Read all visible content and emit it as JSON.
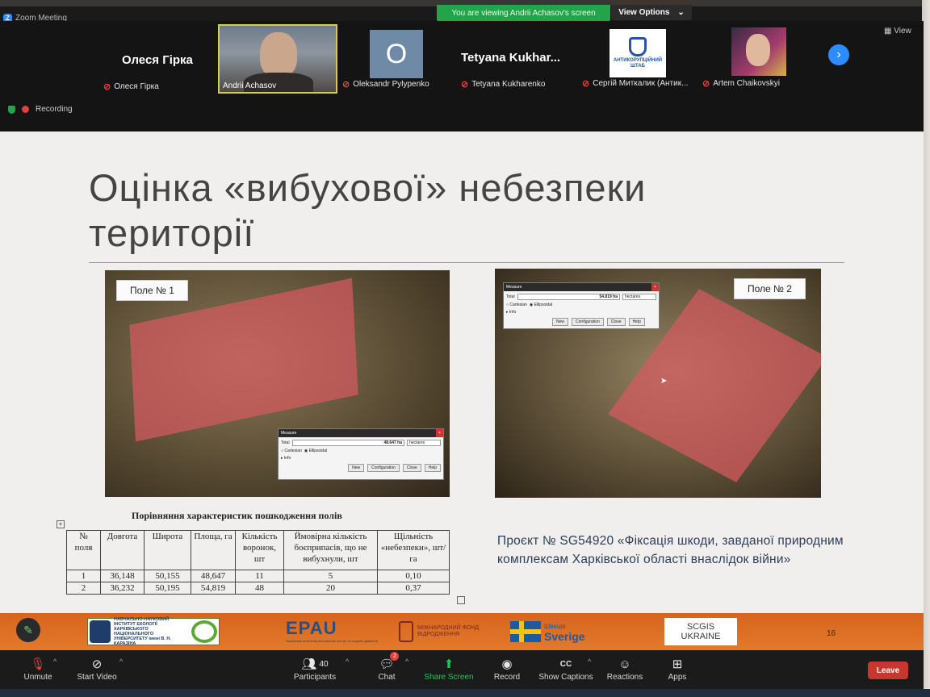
{
  "window": {
    "app_title": "Zoom Meeting",
    "viewing_banner": "You are viewing Andrii Achasov's screen",
    "view_options_label": "View Options",
    "view_label": "View",
    "recording_label": "Recording"
  },
  "participants": [
    {
      "big_name": "Олеся Гірка",
      "label": "Олеся Гірка",
      "muted": true
    },
    {
      "label": "Andrii Achasov",
      "video": true
    },
    {
      "avatar_letter": "O",
      "label": "Oleksandr Pylypenko",
      "muted": true
    },
    {
      "big_name": "Tetyana  Kukhar...",
      "label": "Tetyana Kukharenko",
      "muted": true
    },
    {
      "logo_text": "АНТИКОРУПЦІЙНИЙ ШТАБ",
      "label": "Сергій Миткалик (Антик...",
      "muted": true
    },
    {
      "label": "Artem Chaikovskyi",
      "muted": true
    }
  ],
  "slide": {
    "title_line1": "Оцінка «вибухової» небезпеки",
    "title_line2": "території",
    "field1_label": "Поле № 1",
    "field2_label": "Поле № 2",
    "measure1": {
      "title": "Measure",
      "total_label": "Total",
      "total_value": "48.647 ha",
      "unit": "hectares",
      "opt1": "Cartesian",
      "opt2": "Ellipsoidal",
      "info": "Info",
      "buttons": [
        "New",
        "Configuration",
        "Close",
        "Help"
      ]
    },
    "measure2": {
      "title": "Measure",
      "total_label": "Total",
      "total_value": "54.819 ha",
      "unit": "hectares",
      "opt1": "Cartesian",
      "opt2": "Ellipsoidal",
      "info": "Info",
      "buttons": [
        "New",
        "Configuration",
        "Close",
        "Help"
      ]
    },
    "table_caption": "Порівняння характеристик пошкодження полів",
    "table": {
      "headers": [
        "№ поля",
        "Довгота",
        "Широта",
        "Площа, га",
        "Кількість воронок, шт",
        "Ймовірна кількість боєприпасів, що не вибухнули, шт",
        "Щільність «небезпеки», шт/га"
      ],
      "rows": [
        [
          "1",
          "36,148",
          "50,155",
          "48,647",
          "11",
          "5",
          "0,10"
        ],
        [
          "2",
          "36,232",
          "50,195",
          "54,819",
          "48",
          "20",
          "0,37"
        ]
      ]
    },
    "project_text": "Проєкт № SG54920 «Фіксація шкоди, завданої природним комплексам Харківської області внаслідок війни»",
    "partners": {
      "institute": "НАВЧАЛЬНО-НАУКОВИЙ ІНСТИТУТ ЕКОЛОГІЇ ХАРКІВСЬКОГО НАЦІОНАЛЬНОГО УНІВЕРСИТЕТУ імені В. Н. КАРАЗІНА",
      "epau": "EPAU",
      "epau_sub": "Українське агентство екологічних послуг та охорони довкілля",
      "irf": "МІЖНАРОДНИЙ ФОНД ВІДРОДЖЕННЯ",
      "sweden_small": "Швеція",
      "sweden": "Sverige",
      "scgis1": "SCGIS",
      "scgis2": "UKRAINE"
    },
    "slide_number": "16"
  },
  "controls": {
    "unmute": "Unmute",
    "start_video": "Start Video",
    "participants": "Participants",
    "participants_count": "40",
    "chat": "Chat",
    "chat_badge": "2",
    "share_screen": "Share Screen",
    "record": "Record",
    "captions": "Show Captions",
    "reactions": "Reactions",
    "apps": "Apps",
    "leave": "Leave"
  },
  "colors": {
    "share_green": "#23c35a",
    "leave_red": "#c7372f",
    "banner_green": "#23a34a",
    "footer_orange": "#e27a2a",
    "field_overlay": "#d65a5f"
  }
}
